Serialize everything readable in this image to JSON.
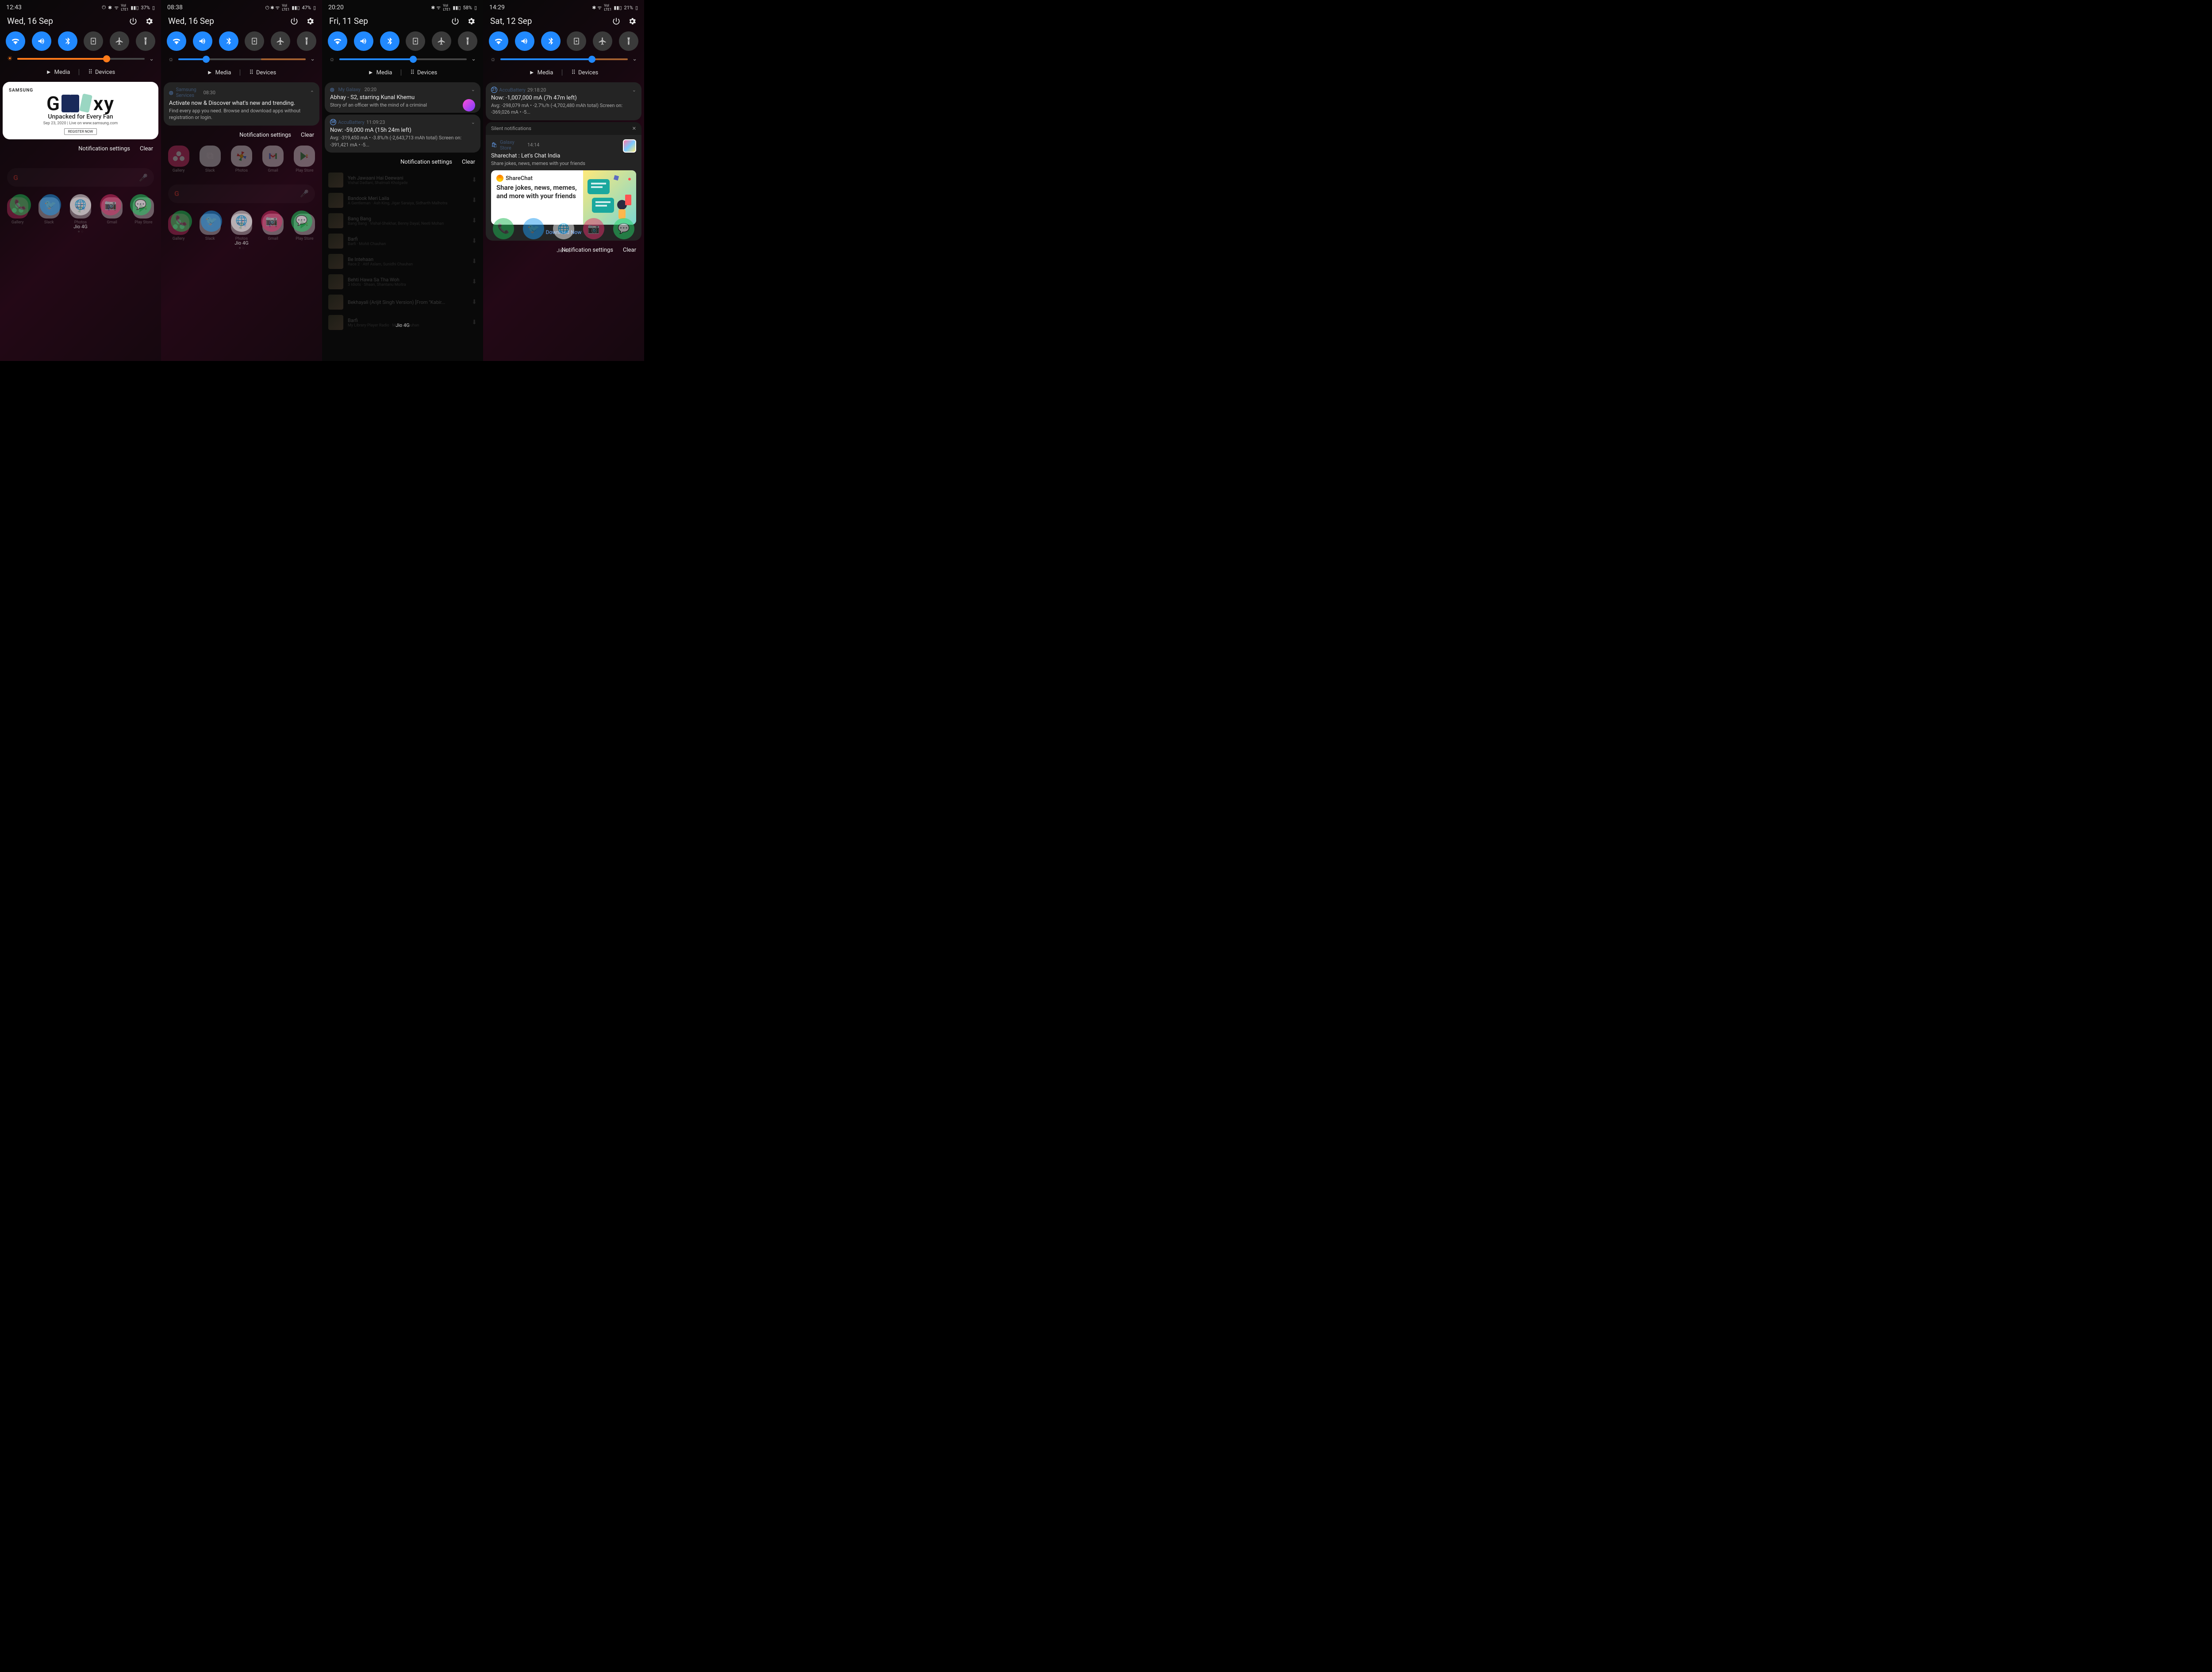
{
  "common": {
    "media_label": "Media",
    "devices_label": "Devices",
    "notif_settings": "Notification settings",
    "clear": "Clear",
    "carrier": "Jio 4G",
    "apps": [
      {
        "label": "Gallery",
        "color": "#e83b78"
      },
      {
        "label": "Slack",
        "color": "#eceff1"
      },
      {
        "label": "Photos",
        "color": "#ffffff"
      },
      {
        "label": "Gmail",
        "color": "#ffffff"
      },
      {
        "label": "Play Store",
        "color": "#ffffff"
      }
    ],
    "dock": [
      {
        "name": "phone",
        "color": "#1db954"
      },
      {
        "name": "twitter",
        "color": "#1d9bf0"
      },
      {
        "name": "chrome",
        "color": "#ffffff"
      },
      {
        "name": "instagram",
        "color": "#e1306c"
      },
      {
        "name": "whatsapp",
        "color": "#25d366"
      }
    ]
  },
  "panels": [
    {
      "time": "12:43",
      "battery": "37%",
      "date": "Wed, 16 Sep",
      "brightness": {
        "pct": 70,
        "color": "#ff7a1a"
      },
      "ad": {
        "brand": "SAMSUNG",
        "headline_left": "G",
        "headline_right": "xy",
        "subtitle": "Unpacked for Every Fan",
        "meta": "Sep 23, 2020 | Live on www.samsung.com",
        "cta": "REGISTER NOW"
      },
      "footer": true,
      "show_home": true,
      "show_search": true
    },
    {
      "time": "08:38",
      "battery": "47%",
      "date": "Wed, 16 Sep",
      "brightness": {
        "pct": 22,
        "color": "#2189ff"
      },
      "cards": [
        {
          "app": "Samsung Services",
          "ts": "08:30",
          "title": "Activate now & Discover what's new and trending.",
          "body": "Find every app you need. Browse and download apps without registration or login."
        }
      ],
      "footer": true,
      "show_home": true,
      "show_search": true
    },
    {
      "time": "20:20",
      "battery": "58%",
      "date": "Fri, 11 Sep",
      "brightness": {
        "pct": 58,
        "color": "#2189ff"
      },
      "cards": [
        {
          "app": "My Galaxy",
          "ts": "20:20",
          "title": "Abhay - S2, starring Kunal Khemu",
          "body": "Story of an officer with the mind of a criminal",
          "side_icon": "linear-gradient(135deg,#ff4fd8,#7a3bff)"
        },
        {
          "app": "AccuBattery",
          "ts": "11:09:23",
          "icon_badge": "58",
          "title": "Now: -59,000 mA (15h 24m left)",
          "body": "Avg: -319,450 mA • -3.8%/h (-2,643,713 mAh total) Screen on: -391,421 mA • -5..."
        }
      ],
      "footer": true,
      "songs": [
        {
          "t": "Yeh Jawaani Hai Deewani",
          "s": "Vishal Dadlani, Shalmali Kholgade"
        },
        {
          "t": "Bandook Meri Laila",
          "s": "A Gentleman · Ash King, Jigar Saraiya, Sidharth Malhotra"
        },
        {
          "t": "Bang Bang",
          "s": "Bang Bang · Vishal-Shekhar, Benny Dayal, Neeti Mohan"
        },
        {
          "t": "Barfi",
          "s": "Barfi · Mohit Chauhan"
        },
        {
          "t": "Be Intehaan",
          "s": "Race 2 · Atif Aslam, Sunidhi Chauhan"
        },
        {
          "t": "Behti Hawa Sa Tha Woh",
          "s": "3 Idiots · Shaan, Shantanu Moitra"
        },
        {
          "t": "Bekhayali (Arijit Singh Version) [From \"Kabir...",
          "s": ""
        },
        {
          "t": "Barfi",
          "s": "My Library·Player Radio · Mohit Chauhan"
        }
      ]
    },
    {
      "time": "14:29",
      "battery": "21%",
      "date": "Sat, 12 Sep",
      "brightness": {
        "pct": 72,
        "color": "#2189ff"
      },
      "cards": [
        {
          "app": "AccuBattery",
          "ts": "29:18:20",
          "icon_badge": "21",
          "title": "Now: -1,007,000 mA (7h 47m left)",
          "body": "Avg: -298,079 mA • -2.7%/h (-4,702,480 mAh total) Screen on: -369,026 mA • -5..."
        }
      ],
      "silent": {
        "header": "Silent notifications",
        "app": "Galaxy Store",
        "ts": "14:14",
        "title": "Sharechat : Let's Chat India",
        "body": "Share jokes, news, memes with your friends",
        "promo_logo": "ShareChat",
        "promo_text": "Share jokes, news, memes, and more with your friends",
        "download": "Download Now"
      },
      "footer": true
    }
  ]
}
